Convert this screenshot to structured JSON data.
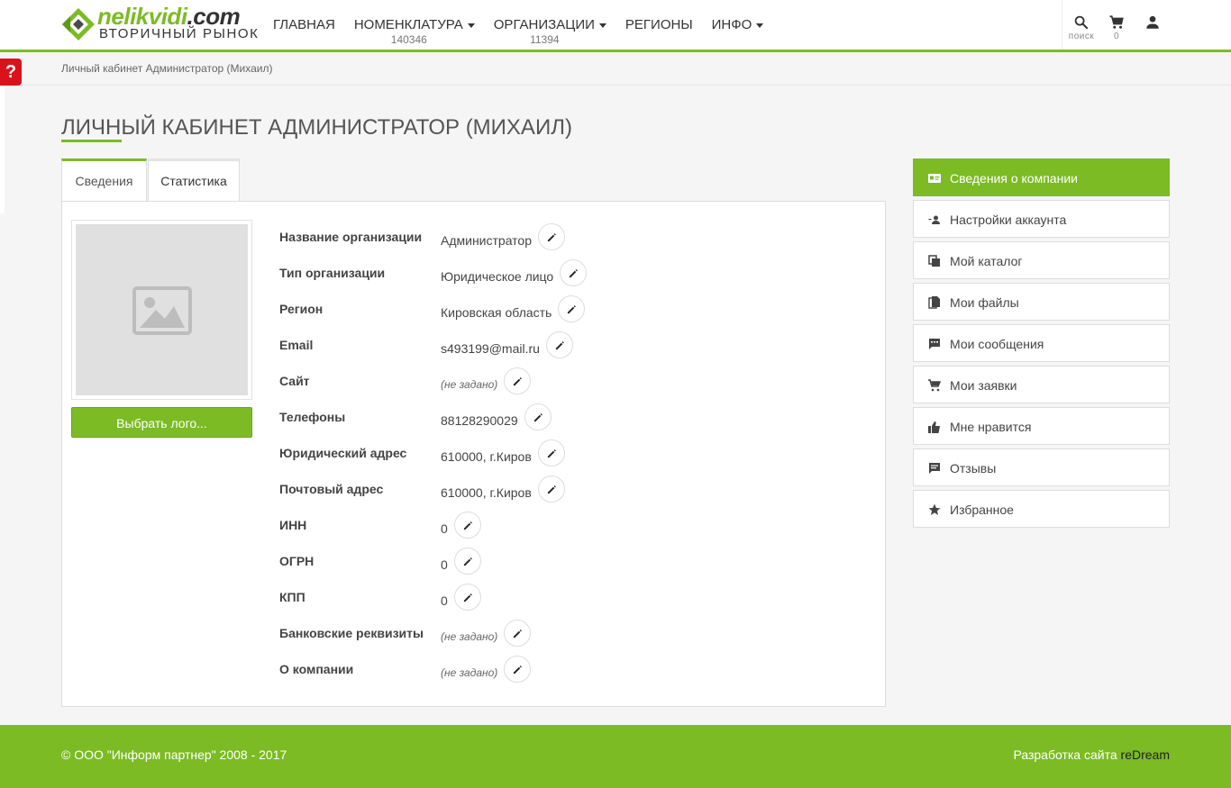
{
  "header": {
    "logo_top_green": "nelikvidi",
    "logo_top_dark": ".com",
    "logo_bottom": "ВТОРИЧНЫЙ РЫНОК",
    "nav": [
      {
        "label": "ГЛАВНАЯ",
        "count": ""
      },
      {
        "label": "НОМЕНКЛАТУРА",
        "count": "140346"
      },
      {
        "label": "ОРГАНИЗАЦИИ",
        "count": "11394"
      },
      {
        "label": "РЕГИОНЫ",
        "count": ""
      },
      {
        "label": "ИНФО",
        "count": ""
      }
    ],
    "search_label": "поиск",
    "cart_count": "0"
  },
  "help_label": "?",
  "breadcrumb": "Личный кабинет Администратор (Михаил)",
  "page_title": "ЛИЧНЫЙ КАБИНЕТ АДМИНИСТРАТОР (МИХАИЛ)",
  "tabs": [
    {
      "label": "Сведения"
    },
    {
      "label": "Статистика"
    }
  ],
  "choose_logo_label": "Выбрать лого...",
  "fields": [
    {
      "label": "Название организации",
      "value": "Администратор",
      "empty": false
    },
    {
      "label": "Тип организации",
      "value": "Юридическое лицо",
      "empty": false
    },
    {
      "label": "Регион",
      "value": "Кировская область",
      "empty": false
    },
    {
      "label": "Email",
      "value": "s493199@mail.ru",
      "empty": false
    },
    {
      "label": "Сайт",
      "value": "(не задано)",
      "empty": true
    },
    {
      "label": "Телефоны",
      "value": "88128290029",
      "empty": false
    },
    {
      "label": "Юридический адрес",
      "value": "610000, г.Киров",
      "empty": false
    },
    {
      "label": "Почтовый адрес",
      "value": "610000, г.Киров",
      "empty": false
    },
    {
      "label": "ИНН",
      "value": "0",
      "empty": false
    },
    {
      "label": "ОГРН",
      "value": "0",
      "empty": false
    },
    {
      "label": "КПП",
      "value": "0",
      "empty": false
    },
    {
      "label": "Банковские реквизиты",
      "value": "(не задано)",
      "empty": true
    },
    {
      "label": "О компании",
      "value": "(не задано)",
      "empty": true
    }
  ],
  "sidebar": [
    {
      "label": "Сведения о компании",
      "icon": "id-card-icon",
      "active": true
    },
    {
      "label": "Настройки аккаунта",
      "icon": "user-settings-icon",
      "active": false
    },
    {
      "label": "Мой каталог",
      "icon": "catalog-icon",
      "active": false
    },
    {
      "label": "Мои файлы",
      "icon": "files-icon",
      "active": false
    },
    {
      "label": "Мои сообщения",
      "icon": "message-icon",
      "active": false
    },
    {
      "label": "Мои заявки",
      "icon": "cart-icon",
      "active": false
    },
    {
      "label": "Мне нравится",
      "icon": "thumb-up-icon",
      "active": false
    },
    {
      "label": "Отзывы",
      "icon": "review-icon",
      "active": false
    },
    {
      "label": "Избранное",
      "icon": "star-icon",
      "active": false
    }
  ],
  "footer": {
    "copyright": "© ООО \"Информ партнер\" 2008 - 2017",
    "dev_prefix": "Разработка сайта ",
    "dev_brand": "reDream"
  },
  "colors": {
    "accent": "#7cbb24",
    "help": "#d9121b"
  }
}
